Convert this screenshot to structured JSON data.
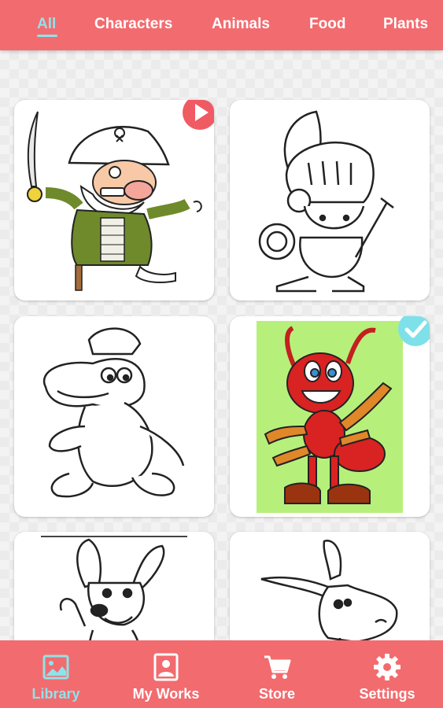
{
  "tabs": [
    {
      "label": "All",
      "active": true
    },
    {
      "label": "Characters",
      "active": false
    },
    {
      "label": "Animals",
      "active": false
    },
    {
      "label": "Food",
      "active": false
    },
    {
      "label": "Plants",
      "active": false
    }
  ],
  "cards": [
    {
      "name": "pirate",
      "badge": "play-icon"
    },
    {
      "name": "knight",
      "badge": ""
    },
    {
      "name": "crocodile",
      "badge": ""
    },
    {
      "name": "ant",
      "badge": "check-icon"
    },
    {
      "name": "dog",
      "badge": ""
    },
    {
      "name": "donkey",
      "badge": ""
    }
  ],
  "bottom_nav": [
    {
      "label": "Library",
      "icon": "image-icon",
      "active": true
    },
    {
      "label": "My Works",
      "icon": "portrait-icon",
      "active": false
    },
    {
      "label": "Store",
      "icon": "cart-icon",
      "active": false
    },
    {
      "label": "Settings",
      "icon": "gear-icon",
      "active": false
    }
  ],
  "colors": {
    "bar": "#f26b6f",
    "accent": "#8ee3ea",
    "play_badge": "#f05a63",
    "check_badge": "#7ee0e8",
    "ant_background": "#b6f07b",
    "ant_body": "#d92222"
  }
}
